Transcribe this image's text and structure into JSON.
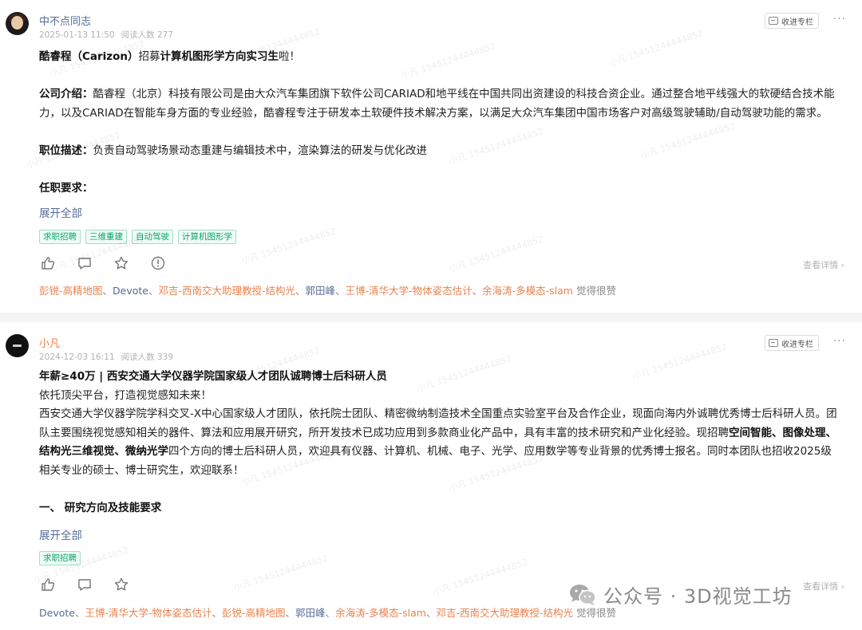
{
  "posts": [
    {
      "author": "中不点同志",
      "date": "2025-01-13 11:50",
      "reads": "阅读人数 277",
      "fav_label": "收进专栏",
      "more_label": "···",
      "headline": {
        "a": "酷睿程（Carizon）",
        "b": "招募",
        "c": "计算机图形学方向实习生",
        "d": "啦！"
      },
      "intro": {
        "label": "公司介绍：",
        "text": "酷睿程（北京）科技有限公司是由大众汽车集团旗下软件公司CARIAD和地平线在中国共同出资建设的科技合资企业。通过整合地平线强大的软硬结合技术能力，以及CARIAD在智能车身方面的专业经验，酷睿程专注于研发本土软硬件技术解决方案，以满足大众汽车集团中国市场客户对高级驾驶辅助/自动驾驶功能的需求。"
      },
      "position": {
        "label": "职位描述：",
        "text": "负责自动驾驶场景动态重建与编辑技术中，渲染算法的研发与优化改进"
      },
      "requirements": {
        "label": "任职要求："
      },
      "expand": "展开全部",
      "tags": [
        "求职招聘",
        "三维重建",
        "自动驾驶",
        "计算机图形学"
      ],
      "detail": "查看详情 ›",
      "likes": {
        "names": [
          {
            "text": "彭锐-高精地图",
            "color": "orange"
          },
          {
            "text": "Devote",
            "color": "blue"
          },
          {
            "text": "邓吉-西南交大助理教授-结构光",
            "color": "orange"
          },
          {
            "text": "郭田峰",
            "color": "blue"
          },
          {
            "text": "王博-清华大学-物体姿态估计",
            "color": "orange"
          },
          {
            "text": "余海涛-多模态-slam",
            "color": "orange"
          }
        ],
        "suffix": " 觉得很赞"
      }
    },
    {
      "author": "小凡",
      "date": "2024-12-03 16:11",
      "reads": "阅读人数 339",
      "fav_label": "收进专栏",
      "more_label": "···",
      "title": "年薪≥40万 | 西安交通大学仪器学院国家级人才团队诚聘博士后科研人员",
      "line2": "依托顶尖平台，打造视觉感知未来！",
      "para_a": "西安交通大学仪器学院学科交叉-X中心国家级人才团队，依托院士团队、精密微纳制造技术全国重点实验室平台及合作企业，现面向海内外诚聘优秀博士后科研人员。团队主要围绕视觉感知相关的器件、算法和应用展开研究，所开发技术已成功应用到多款商业化产品中，具有丰富的技术研究和产业化经验。现招聘",
      "para_bold": "空间智能、图像处理、结构光三维视觉、微纳光学",
      "para_b": "四个方向的博士后科研人员，欢迎具有仪器、计算机、机械、电子、光学、应用数学等专业背景的优秀博士报名。同时本团队也招收2025级相关专业的硕士、博士研究生，欢迎联系！",
      "section": "一、 研究方向及技能要求",
      "expand": "展开全部",
      "tags": [
        "求职招聘"
      ],
      "detail": "查看详情 ›",
      "likes": {
        "names": [
          {
            "text": "Devote",
            "color": "blue"
          },
          {
            "text": "王博-清华大学-物体姿态估计",
            "color": "orange"
          },
          {
            "text": "彭锐-高精地图",
            "color": "orange"
          },
          {
            "text": "郭田峰",
            "color": "blue"
          },
          {
            "text": "余海涛-多模态-slam",
            "color": "orange"
          },
          {
            "text": "邓吉-西南交大助理教授-结构光",
            "color": "orange"
          }
        ],
        "suffix": " 觉得很赞"
      }
    }
  ],
  "watermark_text": "小凡 15451244444852",
  "brand": {
    "label": "公众号 · 3D视觉工坊",
    "icon": "wechat-icon"
  },
  "colors": {
    "link_blue": "#576b95",
    "name_orange": "#e8834e",
    "tag_green": "#07a56a",
    "separator": "#f4f5f7"
  }
}
